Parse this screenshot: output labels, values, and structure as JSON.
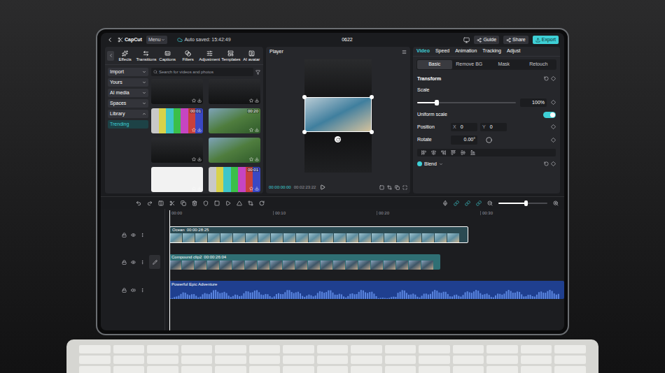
{
  "topbar": {
    "logo": "CapCut",
    "menu": "Menu",
    "autosave": "Auto saved: 15:42:49",
    "project": "0622",
    "buttons": [
      {
        "label": "Guide",
        "kind": "plain"
      },
      {
        "label": "Share",
        "kind": "plain"
      },
      {
        "label": "Export",
        "kind": "primary"
      }
    ]
  },
  "toolbar": [
    {
      "label": "Effects"
    },
    {
      "label": "Transitions"
    },
    {
      "label": "Captions"
    },
    {
      "label": "Filters"
    },
    {
      "label": "Adjustment"
    },
    {
      "label": "Templates"
    },
    {
      "label": "AI avatar"
    }
  ],
  "sidebar": [
    {
      "label": "Import",
      "kind": "group",
      "expanded": false,
      "selected": false
    },
    {
      "label": "Yours",
      "kind": "group",
      "expanded": false,
      "selected": false
    },
    {
      "label": "AI media",
      "kind": "group",
      "expanded": false,
      "selected": false
    },
    {
      "label": "Spaces",
      "kind": "group",
      "expanded": false,
      "selected": false
    },
    {
      "label": "Library",
      "kind": "group",
      "expanded": true,
      "selected": false
    },
    {
      "label": "Trending",
      "kind": "sub",
      "expanded": false,
      "selected": true
    }
  ],
  "search": {
    "placeholder": "Search for videos and photos"
  },
  "media": [
    {
      "kind": "dark"
    },
    {
      "kind": "dark"
    },
    {
      "kind": "bars",
      "duration": "00:01"
    },
    {
      "kind": "photo",
      "duration": "00:20"
    },
    {
      "kind": "dark"
    },
    {
      "kind": "photo"
    },
    {
      "kind": "white"
    },
    {
      "kind": "bars",
      "duration": "00:01"
    }
  ],
  "player": {
    "title": "Player",
    "time": "00:00:00:00",
    "duration": "00:02:23:22"
  },
  "inspector": {
    "tabs": [
      {
        "label": "Video",
        "selected": true
      },
      {
        "label": "Speed",
        "selected": false
      },
      {
        "label": "Animation",
        "selected": false
      },
      {
        "label": "Tracking",
        "selected": false
      },
      {
        "label": "Adjust",
        "selected": false
      }
    ],
    "subtabs": [
      {
        "label": "Basic",
        "selected": true
      },
      {
        "label": "Remove BG",
        "selected": false
      },
      {
        "label": "Mask",
        "selected": false
      },
      {
        "label": "Retouch",
        "selected": false
      }
    ],
    "section": "Transform",
    "scale": {
      "label": "Scale",
      "level": 0.2,
      "value": "100%"
    },
    "uniform": {
      "label": "Uniform scale",
      "on": true
    },
    "position": {
      "label": "Position",
      "x_label": "X",
      "x": "0",
      "y_label": "Y",
      "y": "0"
    },
    "rotate": {
      "label": "Rotate",
      "value": "0.00°"
    },
    "blend": {
      "label": "Blend",
      "checked": true
    }
  },
  "timeline": {
    "ruler": [
      "00:00",
      "00:10",
      "00:20",
      "00:30"
    ],
    "tracks": [
      {
        "kind": "video",
        "name": "Ocean",
        "duration": "00:00:28:25",
        "selected": true
      },
      {
        "kind": "video",
        "name": "Compound clip2",
        "duration": "00:00:26:04",
        "selected": false
      },
      {
        "kind": "audio",
        "name": "Powerful Epic Adventure",
        "selected": false
      }
    ],
    "zoom": {
      "level": 0.55
    }
  }
}
